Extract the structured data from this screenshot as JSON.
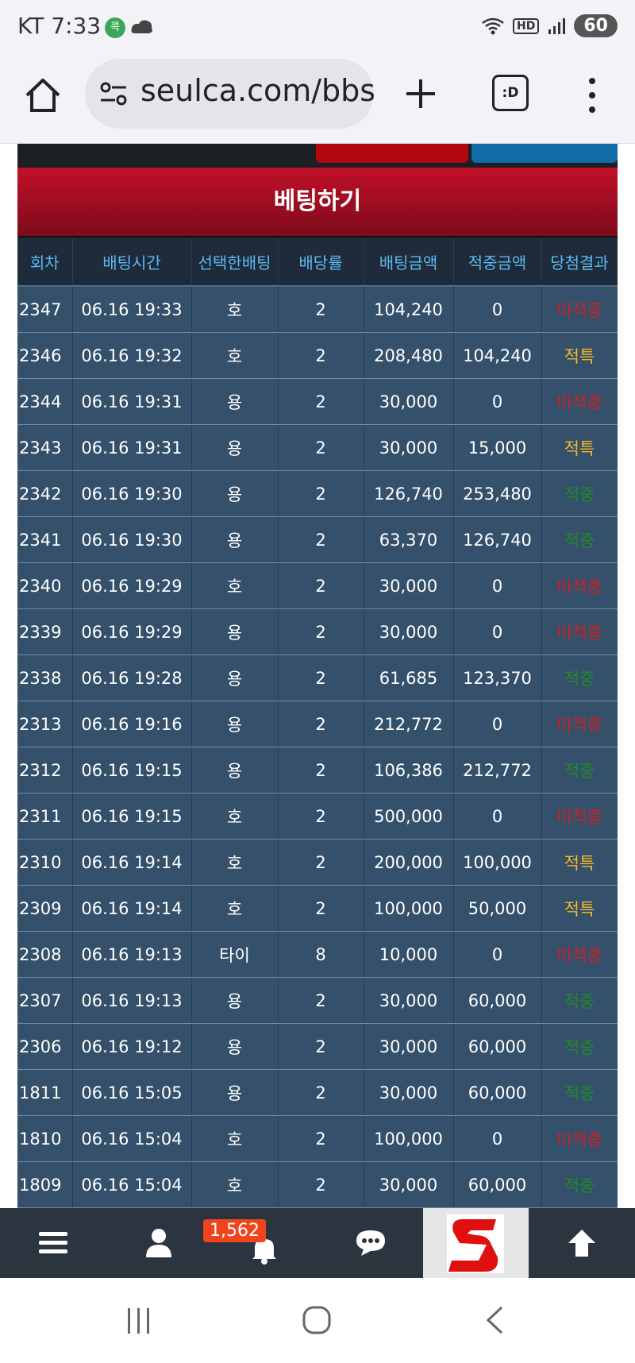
{
  "status_bar": {
    "carrier": "KT",
    "time": "7:33",
    "app_icon_1": "콕",
    "battery": "60",
    "hd_label": "HD"
  },
  "browser": {
    "url": "seulca.com/bbs",
    "tabs_label": ":D"
  },
  "page": {
    "section_title": "베팅하기",
    "columns": [
      "회차",
      "배팅시간",
      "선택한배팅",
      "배당률",
      "배팅금액",
      "적중금액",
      "당첨결과"
    ],
    "rows": [
      {
        "round": "2347",
        "time": "06.16 19:33",
        "choice": "호",
        "odds": "2",
        "bet": "104,240",
        "win": "0",
        "result": "미적중",
        "result_type": "lose"
      },
      {
        "round": "2346",
        "time": "06.16 19:32",
        "choice": "호",
        "odds": "2",
        "bet": "208,480",
        "win": "104,240",
        "result": "적특",
        "result_type": "tie"
      },
      {
        "round": "2344",
        "time": "06.16 19:31",
        "choice": "용",
        "odds": "2",
        "bet": "30,000",
        "win": "0",
        "result": "미적중",
        "result_type": "lose"
      },
      {
        "round": "2343",
        "time": "06.16 19:31",
        "choice": "용",
        "odds": "2",
        "bet": "30,000",
        "win": "15,000",
        "result": "적특",
        "result_type": "tie"
      },
      {
        "round": "2342",
        "time": "06.16 19:30",
        "choice": "용",
        "odds": "2",
        "bet": "126,740",
        "win": "253,480",
        "result": "적중",
        "result_type": "win"
      },
      {
        "round": "2341",
        "time": "06.16 19:30",
        "choice": "용",
        "odds": "2",
        "bet": "63,370",
        "win": "126,740",
        "result": "적중",
        "result_type": "win"
      },
      {
        "round": "2340",
        "time": "06.16 19:29",
        "choice": "호",
        "odds": "2",
        "bet": "30,000",
        "win": "0",
        "result": "미적중",
        "result_type": "lose"
      },
      {
        "round": "2339",
        "time": "06.16 19:29",
        "choice": "용",
        "odds": "2",
        "bet": "30,000",
        "win": "0",
        "result": "미적중",
        "result_type": "lose"
      },
      {
        "round": "2338",
        "time": "06.16 19:28",
        "choice": "용",
        "odds": "2",
        "bet": "61,685",
        "win": "123,370",
        "result": "적중",
        "result_type": "win"
      },
      {
        "round": "2313",
        "time": "06.16 19:16",
        "choice": "용",
        "odds": "2",
        "bet": "212,772",
        "win": "0",
        "result": "미적중",
        "result_type": "lose"
      },
      {
        "round": "2312",
        "time": "06.16 19:15",
        "choice": "용",
        "odds": "2",
        "bet": "106,386",
        "win": "212,772",
        "result": "적중",
        "result_type": "win"
      },
      {
        "round": "2311",
        "time": "06.16 19:15",
        "choice": "호",
        "odds": "2",
        "bet": "500,000",
        "win": "0",
        "result": "미적중",
        "result_type": "lose"
      },
      {
        "round": "2310",
        "time": "06.16 19:14",
        "choice": "호",
        "odds": "2",
        "bet": "200,000",
        "win": "100,000",
        "result": "적특",
        "result_type": "tie"
      },
      {
        "round": "2309",
        "time": "06.16 19:14",
        "choice": "호",
        "odds": "2",
        "bet": "100,000",
        "win": "50,000",
        "result": "적특",
        "result_type": "tie"
      },
      {
        "round": "2308",
        "time": "06.16 19:13",
        "choice": "타이",
        "odds": "8",
        "bet": "10,000",
        "win": "0",
        "result": "미적중",
        "result_type": "lose"
      },
      {
        "round": "2307",
        "time": "06.16 19:13",
        "choice": "용",
        "odds": "2",
        "bet": "30,000",
        "win": "60,000",
        "result": "적중",
        "result_type": "win"
      },
      {
        "round": "2306",
        "time": "06.16 19:12",
        "choice": "용",
        "odds": "2",
        "bet": "30,000",
        "win": "60,000",
        "result": "적중",
        "result_type": "win"
      },
      {
        "round": "1811",
        "time": "06.16 15:05",
        "choice": "용",
        "odds": "2",
        "bet": "30,000",
        "win": "60,000",
        "result": "적중",
        "result_type": "win"
      },
      {
        "round": "1810",
        "time": "06.16 15:04",
        "choice": "호",
        "odds": "2",
        "bet": "100,000",
        "win": "0",
        "result": "미적중",
        "result_type": "lose"
      },
      {
        "round": "1809",
        "time": "06.16 15:04",
        "choice": "호",
        "odds": "2",
        "bet": "30,000",
        "win": "60,000",
        "result": "적중",
        "result_type": "win"
      }
    ]
  },
  "bottom_nav": {
    "notification_count": "1,562",
    "items": [
      "menu-icon",
      "user-icon",
      "bell-icon",
      "chat-icon",
      "site-logo",
      "arrow-up-icon"
    ]
  },
  "colors": {
    "lose": "#d21e24",
    "tie": "#f4b82a",
    "win": "#1f8a2a",
    "header_text": "#5fb8f0",
    "title_bar": "#a80c22"
  }
}
